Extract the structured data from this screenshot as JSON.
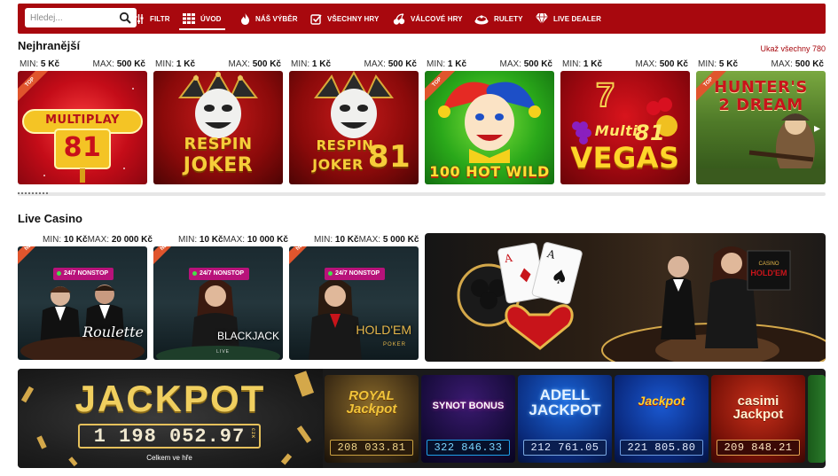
{
  "nav": {
    "search_placeholder": "Hledej...",
    "items": [
      {
        "label": "FILTR",
        "icon": "filter-icon"
      },
      {
        "label": "ÚVOD",
        "icon": "grid-icon",
        "active": true
      },
      {
        "label": "NÁŠ VÝBĚR",
        "icon": "flame-icon"
      },
      {
        "label": "VŠECHNY HRY",
        "icon": "checkbox-icon"
      },
      {
        "label": "VÁLCOVÉ HRY",
        "icon": "cherries-icon"
      },
      {
        "label": "RULETY",
        "icon": "roulette-icon"
      },
      {
        "label": "LIVE DEALER",
        "icon": "diamond-icon"
      }
    ]
  },
  "popular": {
    "title": "Nejhranější",
    "show_all": "Ukaž všechny 780",
    "games": [
      {
        "badge": "TOP",
        "min_label": "MIN:",
        "min": "5 Kč",
        "max_label": "MAX:",
        "max": "500 Kč",
        "name": "MULTIPLAY 81"
      },
      {
        "badge": "",
        "min_label": "MIN:",
        "min": "1 Kč",
        "max_label": "MAX:",
        "max": "500 Kč",
        "name": "RESPIN JOKER"
      },
      {
        "badge": "",
        "min_label": "MIN:",
        "min": "1 Kč",
        "max_label": "MAX:",
        "max": "500 Kč",
        "name": "RESPIN JOKER 81"
      },
      {
        "badge": "TOP",
        "min_label": "MIN:",
        "min": "1 Kč",
        "max_label": "MAX:",
        "max": "500 Kč",
        "name": "100 HOT WILD"
      },
      {
        "badge": "",
        "min_label": "MIN:",
        "min": "1 Kč",
        "max_label": "MAX:",
        "max": "500 Kč",
        "name": "Multi 81 VEGAS"
      },
      {
        "badge": "TOP",
        "min_label": "MIN:",
        "min": "5 Kč",
        "max_label": "MAX:",
        "max": "500 Kč",
        "name": "HUNTER'S 2 DREAM"
      }
    ]
  },
  "live": {
    "title": "Live Casino",
    "games": [
      {
        "badge": "NEW",
        "min_label": "MIN:",
        "min": "10 Kč",
        "max_label": "MAX:",
        "max": "20 000 Kč",
        "nonstop": "24/7 NONSTOP",
        "name": "Roulette",
        "sub": ""
      },
      {
        "badge": "NEW",
        "min_label": "MIN:",
        "min": "10 Kč",
        "max_label": "MAX:",
        "max": "10 000 Kč",
        "nonstop": "24/7 NONSTOP",
        "name": "BLACKJACK",
        "sub": "LIVE"
      },
      {
        "badge": "NEW",
        "min_label": "MIN:",
        "min": "10 Kč",
        "max_label": "MAX:",
        "max": "5 000 Kč",
        "nonstop": "24/7 NONSTOP",
        "name": "HOLD'EM",
        "sub": "POKER"
      }
    ]
  },
  "jackpot": {
    "title": "JACKPOT",
    "amount": "1 198 052.97",
    "currency": "CZK",
    "label": "Celkem ve hře",
    "cards": [
      {
        "name": "ROYAL Jackpot",
        "value": "208 033.81"
      },
      {
        "name": "SYNOT BONUS",
        "value": "322 846.33"
      },
      {
        "name": "ADELL JACKPOT",
        "value": "212 761.05"
      },
      {
        "name": "Jackpot",
        "value": "221 805.80"
      },
      {
        "name": "casimi Jackpot",
        "value": "209 848.21"
      }
    ]
  }
}
